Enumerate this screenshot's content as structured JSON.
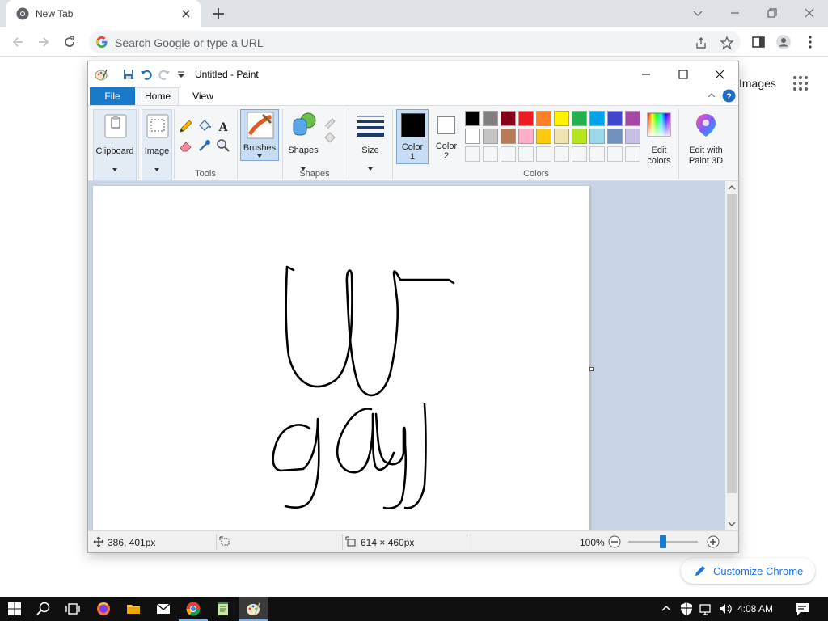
{
  "chrome": {
    "tab_title": "New Tab",
    "omnibox_placeholder": "Search Google or type a URL",
    "images_link": "Images",
    "customize_label": "Customize Chrome"
  },
  "paint": {
    "window_title": "Untitled - Paint",
    "tabs": {
      "file": "File",
      "home": "Home",
      "view": "View"
    },
    "groups": {
      "clipboard": "Clipboard",
      "image": "Image",
      "tools": "Tools",
      "brushes": "Brushes",
      "shapes": "Shapes",
      "size": "Size",
      "color1": "Color",
      "color1_num": "1",
      "color2": "Color",
      "color2_num": "2",
      "colors": "Colors",
      "edit_colors_1": "Edit",
      "edit_colors_2": "colors",
      "paint3d_1": "Edit with",
      "paint3d_2": "Paint 3D"
    },
    "palette_row1": [
      "#000000",
      "#7f7f7f",
      "#880015",
      "#ed1c24",
      "#ff7f27",
      "#fff200",
      "#22b14c",
      "#00a2e8",
      "#3f48cc",
      "#a349a4"
    ],
    "palette_row2": [
      "#ffffff",
      "#c3c3c3",
      "#b97a57",
      "#ffaec9",
      "#ffc90e",
      "#efe4b0",
      "#b5e61d",
      "#99d9ea",
      "#7092be",
      "#c8bfe7"
    ],
    "color1_value": "#000000",
    "color2_value": "#ffffff",
    "status": {
      "cursor_pos": "386, 401px",
      "canvas_size": "614 × 460px",
      "zoom": "100%",
      "zoom_level": 0.5
    }
  },
  "taskbar": {
    "time": "4:08 AM"
  }
}
